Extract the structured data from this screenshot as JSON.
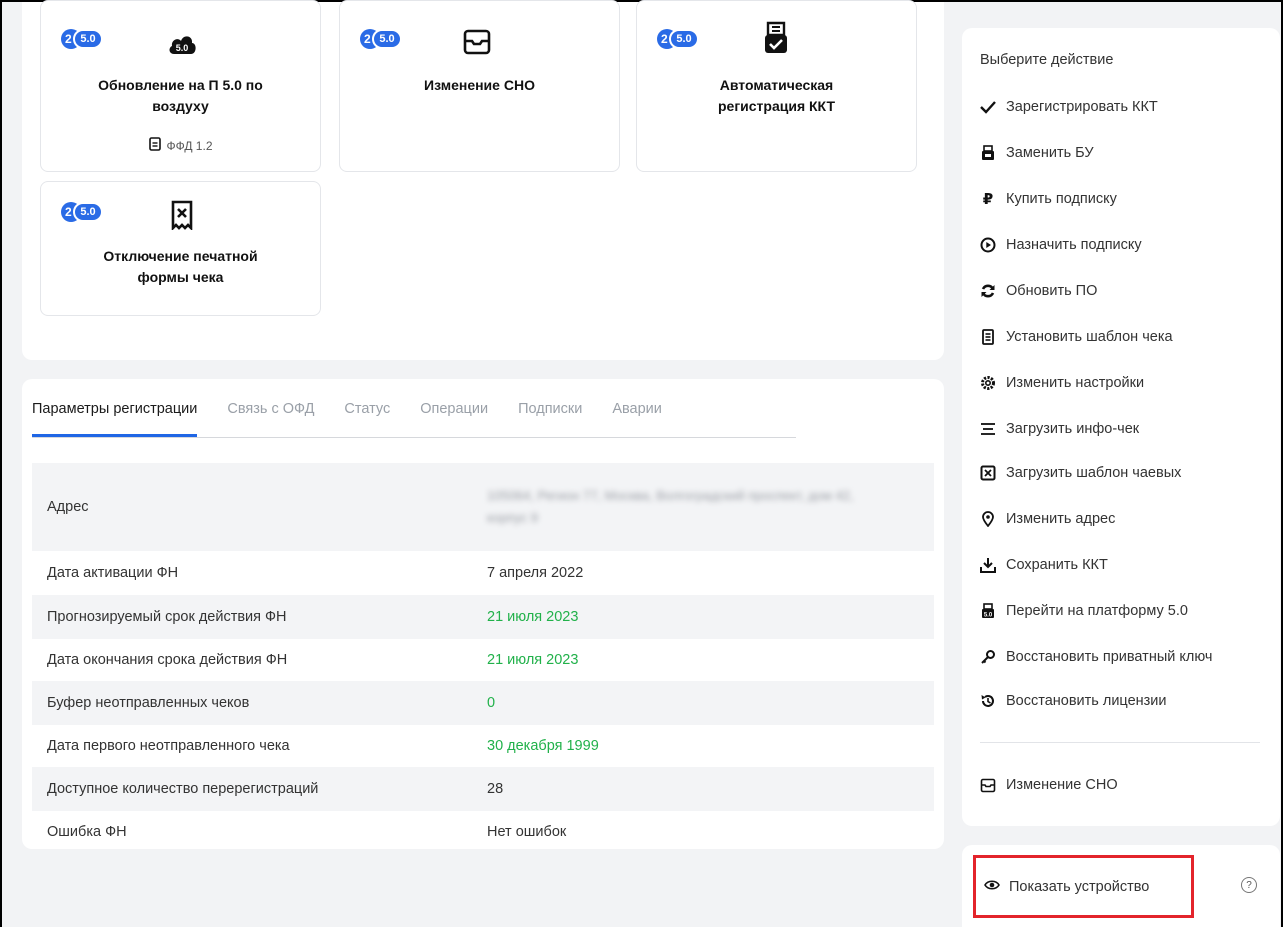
{
  "tiles": [
    {
      "badge_num": "2",
      "badge_ver": "5.0",
      "title": "Обновление на П 5.0 по воздуху",
      "subtitle": "ФФД 1.2",
      "icon": "cloud-5-icon"
    },
    {
      "badge_num": "2",
      "badge_ver": "5.0",
      "title": "Изменение СНО",
      "icon": "tray-icon"
    },
    {
      "badge_num": "2",
      "badge_ver": "5.0",
      "title": "Автоматическая регистрация ККТ",
      "icon": "receipt-check-icon"
    },
    {
      "badge_num": "2",
      "badge_ver": "5.0",
      "title": "Отключение печатной формы чека",
      "icon": "receipt-x-icon"
    }
  ],
  "tabs": [
    "Параметры регистрации",
    "Связь с ОФД",
    "Статус",
    "Операции",
    "Подписки",
    "Аварии"
  ],
  "active_tab": "Параметры регистрации",
  "params": [
    {
      "label": "Адрес",
      "value": "105064, Регион 77, Москва, Волгоградский проспект, дом 42, корпус 9",
      "blurred": true
    },
    {
      "label": "Дата активации ФН",
      "value": "7 апреля 2022"
    },
    {
      "label": "Прогнозируемый срок действия ФН",
      "value": "21 июля 2023",
      "color": "green"
    },
    {
      "label": "Дата окончания срока действия ФН",
      "value": "21 июля 2023",
      "color": "green"
    },
    {
      "label": "Буфер неотправленных чеков",
      "value": "0",
      "color": "green"
    },
    {
      "label": "Дата первого неотправленного чека",
      "value": "30 декабря 1999",
      "color": "green"
    },
    {
      "label": "Доступное количество перерегистраций",
      "value": "28"
    },
    {
      "label": "Ошибка ФН",
      "value": "Нет ошибок"
    }
  ],
  "actions": {
    "title": "Выберите действие",
    "items": [
      {
        "label": "Зарегистрировать ККТ",
        "icon": "check-icon"
      },
      {
        "label": "Заменить БУ",
        "icon": "device-icon"
      },
      {
        "label": "Купить подписку",
        "icon": "ruble-icon"
      },
      {
        "label": "Назначить подписку",
        "icon": "play-circle-icon"
      },
      {
        "label": "Обновить ПО",
        "icon": "refresh-icon"
      },
      {
        "label": "Установить шаблон чека",
        "icon": "document-icon"
      },
      {
        "label": "Изменить настройки",
        "icon": "gear-icon"
      },
      {
        "label": "Загрузить инфо-чек",
        "icon": "lines-icon"
      },
      {
        "label": "Загрузить шаблон чаевых",
        "icon": "tips-template-icon"
      },
      {
        "label": "Изменить адрес",
        "icon": "location-pin-icon"
      },
      {
        "label": "Сохранить ККТ",
        "icon": "download-icon"
      },
      {
        "label": "Перейти на платформу 5.0",
        "icon": "platform-icon"
      },
      {
        "label": "Восстановить приватный ключ",
        "icon": "key-icon"
      },
      {
        "label": "Восстановить лицензии",
        "icon": "restore-icon"
      }
    ],
    "extra": {
      "label": "Изменение СНО",
      "icon": "tray-icon"
    }
  },
  "show_device": {
    "label": "Показать устройство",
    "icon": "eye-icon",
    "help": "?"
  }
}
